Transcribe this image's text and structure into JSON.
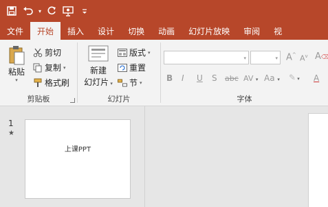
{
  "qat": {
    "items": [
      "save-icon",
      "undo-icon",
      "redo-icon",
      "present-icon",
      "customize-icon"
    ]
  },
  "tabs": [
    "文件",
    "开始",
    "插入",
    "设计",
    "切换",
    "动画",
    "幻灯片放映",
    "审阅",
    "视"
  ],
  "active_tab": "开始",
  "clipboard": {
    "paste": "粘贴",
    "cut": "剪切",
    "copy": "复制",
    "format_painter": "格式刷",
    "label": "剪贴板"
  },
  "slides": {
    "new_slide_line1": "新建",
    "new_slide_line2": "幻灯片",
    "layout": "版式",
    "reset": "重置",
    "section": "节",
    "label": "幻灯片"
  },
  "font": {
    "label": "字体",
    "row2": [
      "B",
      "I",
      "U",
      "S",
      "abc",
      "AV",
      "Aa",
      "A"
    ]
  },
  "thumbnail": {
    "number": "1",
    "star": "★",
    "text": "上课PPT"
  },
  "colors": {
    "accent": "#b7472a",
    "ribbon": "#f3f3f3",
    "workspace": "#e6e6e6"
  }
}
